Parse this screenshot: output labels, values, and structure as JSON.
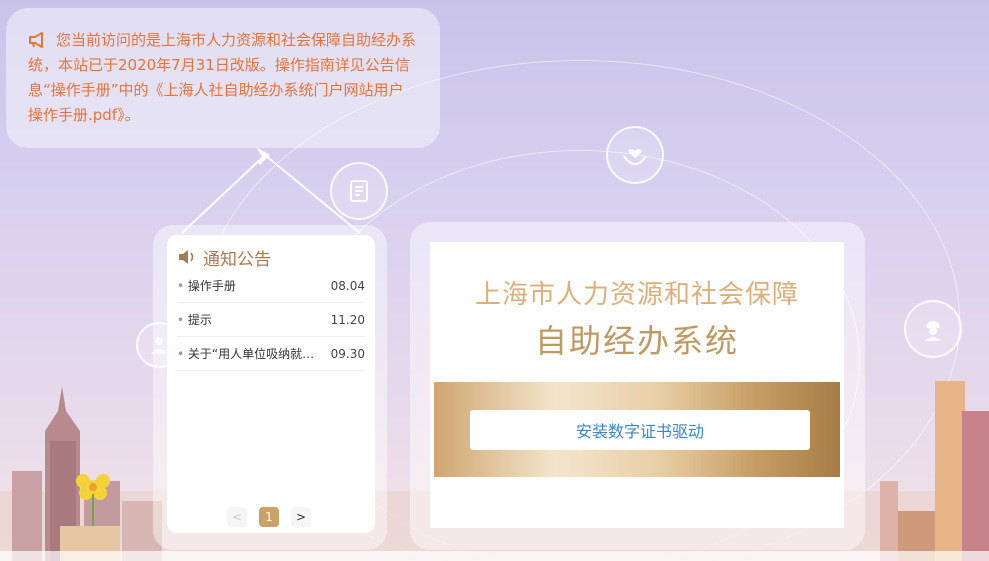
{
  "notice": {
    "text": "您当前访问的是上海市人力资源和社会保障自助经办系统，本站已于2020年7月31日改版。操作指南详见公告信息“操作手册”中的《上海人社自助经办系统门户网站用户操作手册.pdf》。",
    "icon": "megaphone-icon"
  },
  "announcements": {
    "title": "通知公告",
    "icon": "speaker-icon",
    "items": [
      {
        "name": "操作手册",
        "date": "08.04"
      },
      {
        "name": "提示",
        "date": "11.20"
      },
      {
        "name": "关于“用人单位吸纳就业困难人员",
        "date": "09.30"
      }
    ],
    "pager": {
      "prev": "<",
      "current": "1",
      "next": ">"
    }
  },
  "main": {
    "title_line1": "上海市人力资源和社会保障",
    "title_line2": "自助经办系统",
    "install_button": "安装数字证书驱动"
  },
  "colors": {
    "notice_text": "#e8733a",
    "accent_gold": "#c09862",
    "button_text": "#3a86c8"
  }
}
